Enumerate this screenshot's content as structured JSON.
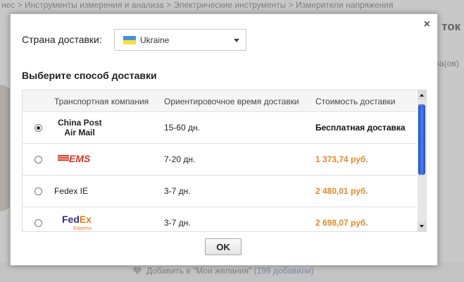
{
  "background": {
    "breadcrumb": "нес > Инструменты измерения и анализа > Электрические инструменты > Измерители напряжения",
    "side_title": "и ток",
    "side_note": "аза(ов)",
    "wishlist_text": "Добавить в \"Мои желания\"",
    "wishlist_count": "(199 добавили)"
  },
  "dialog": {
    "close_symbol": "×",
    "country_label": "Страна доставки:",
    "country_value": "Ukraine",
    "method_title": "Выберите способ доставки",
    "columns": {
      "carrier": "Транспортная компания",
      "time": "Ориентировочное время доставки",
      "cost": "Стоимость доставки"
    },
    "rows": [
      {
        "carrier_line1": "China Post",
        "carrier_line2": "Air Mail",
        "time": "15-60 дн.",
        "cost": "Бесплатная доставка",
        "selected": true
      },
      {
        "carrier_logo": "EMS",
        "time": "7-20 дн.",
        "cost": "1 373,74 руб.",
        "selected": false
      },
      {
        "carrier": "Fedex IE",
        "time": "3-7 дн.",
        "cost": "2 480,01 руб.",
        "selected": false
      },
      {
        "carrier_logo_fe": "Fed",
        "carrier_logo_ex": "Ex",
        "carrier_logo_sub": "Express",
        "time": "3-7 дн.",
        "cost": "2 698,07 руб.",
        "selected": false
      }
    ],
    "ok_label": "OK",
    "colors": {
      "price": "#e08a2a",
      "scroll_thumb": "#1f4fc8",
      "flag_blue": "#4a8fe0",
      "flag_yellow": "#f5e23a"
    }
  }
}
